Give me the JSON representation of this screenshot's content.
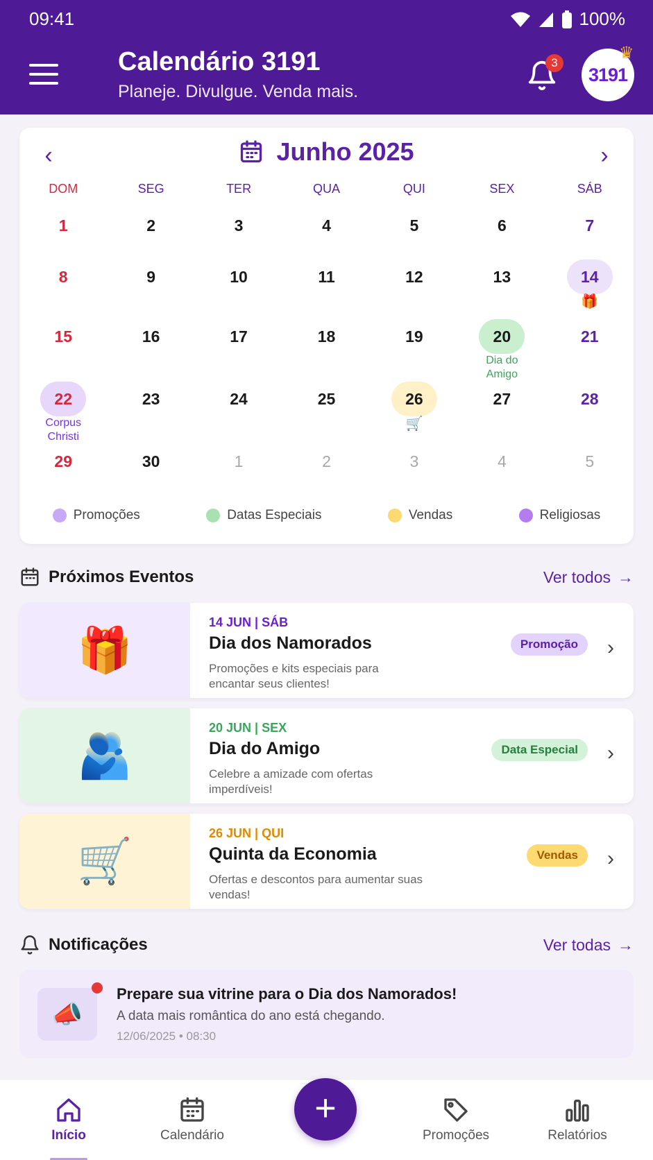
{
  "status": {
    "time": "09:41",
    "battery": "100%"
  },
  "header": {
    "title": "Calendário 3191",
    "subtitle": "Planeje. Divulgue. Venda mais.",
    "notification_count": "3",
    "avatar_text": "3191"
  },
  "calendar": {
    "month_label": "Junho 2025",
    "weekdays": [
      "DOM",
      "SEG",
      "TER",
      "QUA",
      "QUI",
      "SEX",
      "SÁB"
    ],
    "weeks": [
      [
        "1",
        "2",
        "3",
        "4",
        "5",
        "6",
        "7"
      ],
      [
        "8",
        "9",
        "10",
        "11",
        "12",
        "13",
        "14"
      ],
      [
        "15",
        "16",
        "17",
        "18",
        "19",
        "20",
        "21"
      ],
      [
        "22",
        "23",
        "24",
        "25",
        "26",
        "27",
        "28"
      ],
      [
        "29",
        "30",
        "1",
        "2",
        "3",
        "4",
        "5"
      ]
    ],
    "highlights": {
      "14": {
        "type": "promo",
        "icon": "gift-icon"
      },
      "20": {
        "type": "special",
        "label": "Dia do Amigo"
      },
      "22": {
        "type": "religious",
        "label": "Corpus Christi"
      },
      "26": {
        "type": "sales",
        "icon": "cart-icon"
      }
    },
    "legend": [
      {
        "label": "Promoções",
        "color": "#c9a8f5"
      },
      {
        "label": "Datas Especiais",
        "color": "#a9e2b2"
      },
      {
        "label": "Vendas",
        "color": "#fcd971"
      },
      {
        "label": "Religiosas",
        "color": "#b57cf0"
      }
    ]
  },
  "events_section": {
    "title": "Próximos Eventos",
    "link": "Ver todos"
  },
  "events": [
    {
      "date": "14 JUN | SÁB",
      "title": "Dia dos Namorados",
      "desc": "Promoções e kits especiais para encantar seus clientes!",
      "tag": "Promoção",
      "date_color": "#6a1fd0",
      "tag_bg": "#e3d2fb",
      "tag_color": "#5b21a8",
      "thumb_bg": "#f1e9fd",
      "icon": "gift-icon",
      "glyph": "🎁"
    },
    {
      "date": "20 JUN | SEX",
      "title": "Dia do Amigo",
      "desc": "Celebre a amizade com ofertas imperdíveis!",
      "tag": "Data Especial",
      "date_color": "#3ba55c",
      "tag_bg": "#d3f2d8",
      "tag_color": "#23803f",
      "thumb_bg": "#e3f6e6",
      "icon": "friends-hug-icon",
      "glyph": "🫂"
    },
    {
      "date": "26 JUN | QUI",
      "title": "Quinta da Economia",
      "desc": "Ofertas e descontos para aumentar suas vendas!",
      "tag": "Vendas",
      "date_color": "#e08a00",
      "tag_bg": "#fcd971",
      "tag_color": "#a15c00",
      "thumb_bg": "#fff3d6",
      "icon": "cart-icon",
      "glyph": "🛒"
    }
  ],
  "notifications_section": {
    "title": "Notificações",
    "link": "Ver todas"
  },
  "notification": {
    "title": "Prepare sua vitrine para o Dia dos Namorados!",
    "body": "A data mais romântica do ano está chegando.",
    "date": "12/06/2025",
    "time": "08:30"
  },
  "nav": [
    {
      "label": "Início",
      "icon": "home-icon"
    },
    {
      "label": "Calendário",
      "icon": "calendar-icon"
    },
    {
      "label": "Promoções",
      "icon": "tag-icon"
    },
    {
      "label": "Relatórios",
      "icon": "bar-chart-icon"
    }
  ]
}
